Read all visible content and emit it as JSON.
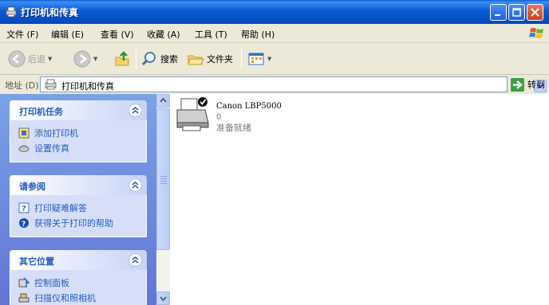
{
  "window": {
    "title": "打印机和传真"
  },
  "menu": {
    "items": [
      "文件 (F)",
      "编辑 (E)",
      "查看 (V)",
      "收藏 (A)",
      "工具 (T)",
      "帮助 (H)"
    ]
  },
  "toolbar": {
    "back_label": "后退",
    "search_label": "搜索",
    "folders_label": "文件夹"
  },
  "address": {
    "label": "地址 (D)",
    "value": "打印机和传真",
    "go_label": "转到"
  },
  "tasks": {
    "printer_tasks": {
      "title": "打印机任务",
      "items": [
        "添加打印机",
        "设置传真"
      ]
    },
    "see_also": {
      "title": "请参阅",
      "items": [
        "打印疑难解答",
        "获得关于打印的帮助"
      ]
    },
    "other_places": {
      "title": "其它位置",
      "items": [
        "控制面板",
        "扫描仪和照相机"
      ]
    }
  },
  "printers": [
    {
      "name": "Canon LBP5000",
      "documents": "0",
      "status": "准备就绪"
    }
  ],
  "colors": {
    "title_bar": "#0a5fd8",
    "pane_bg": "#7ba2e7",
    "task_text": "#215dc6",
    "chrome": "#ece9d8"
  }
}
